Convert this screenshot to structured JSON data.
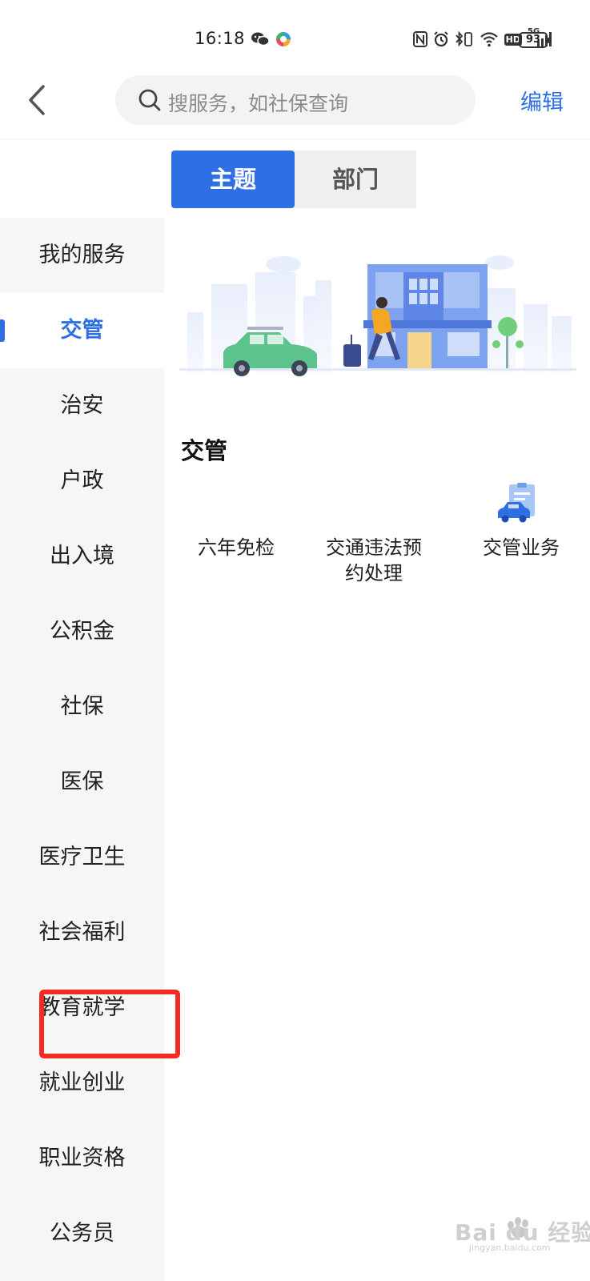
{
  "status_bar": {
    "time": "16:18",
    "network": "5G",
    "hd": "HD",
    "battery": "93"
  },
  "header": {
    "search_placeholder": "搜服务，如社保查询",
    "edit_label": "编辑"
  },
  "tabs": [
    {
      "label": "主题",
      "active": true
    },
    {
      "label": "部门",
      "active": false
    }
  ],
  "sidebar": {
    "items": [
      {
        "label": "我的服务"
      },
      {
        "label": "交管",
        "active": true
      },
      {
        "label": "治安"
      },
      {
        "label": "户政"
      },
      {
        "label": "出入境"
      },
      {
        "label": "公积金"
      },
      {
        "label": "社保"
      },
      {
        "label": "医保"
      },
      {
        "label": "医疗卫生"
      },
      {
        "label": "社会福利"
      },
      {
        "label": "教育就学"
      },
      {
        "label": "就业创业"
      },
      {
        "label": "职业资格"
      },
      {
        "label": "公务员"
      }
    ]
  },
  "main": {
    "section_title": "交管",
    "services": [
      {
        "label": "六年免检"
      },
      {
        "label": "交通违法预约处理"
      },
      {
        "label": "交管业务",
        "icon": "car-document-icon"
      }
    ]
  },
  "watermark": {
    "text": "Bai du 经验",
    "sub": "jingyan.baidu.com"
  },
  "colors": {
    "accent": "#2f6fe4",
    "highlight": "#f52a22",
    "sidebar_bg": "#f6f6f6"
  }
}
